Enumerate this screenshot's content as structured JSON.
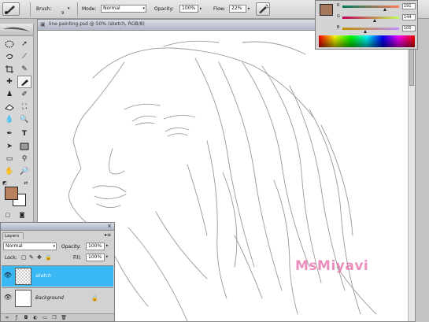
{
  "options_bar": {
    "brush_label": "Brush:",
    "brush_size": "9",
    "mode_label": "Mode:",
    "mode_value": "Normal",
    "opacity_label": "Opacity:",
    "opacity_value": "100%",
    "flow_label": "Flow:",
    "flow_value": "22%"
  },
  "document": {
    "title": "line painting.psd @ 50% (sketch, RGB/8)",
    "watermark": "MsMiyavi"
  },
  "color_panel": {
    "foreground_color": "#a7775d",
    "channels": [
      {
        "label": "R",
        "value": "191"
      },
      {
        "label": "G",
        "value": "144"
      },
      {
        "label": "B",
        "value": "100"
      }
    ]
  },
  "toolbox": {
    "foreground_color": "#b9805e",
    "background_color": "#ffffff"
  },
  "layers_panel": {
    "tab_label": "Layers",
    "blend_mode": "Normal",
    "opacity_label": "Opacity:",
    "opacity_value": "100%",
    "lock_label": "Lock:",
    "fill_label": "Fill:",
    "fill_value": "100%",
    "layers": [
      {
        "name": "sketch",
        "selected": true,
        "selected_color": "#39b8f4"
      },
      {
        "name": "Background",
        "selected": false
      }
    ]
  }
}
